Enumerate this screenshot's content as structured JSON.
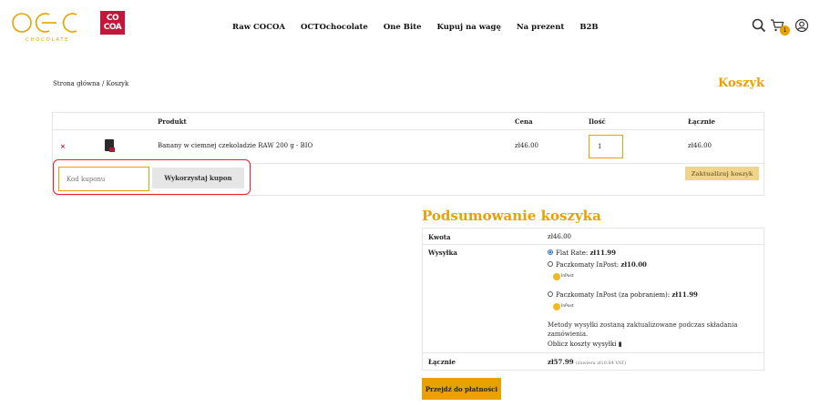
{
  "brand": {
    "logo_top": "CO\nCOA",
    "logo_sub": "CHOCOLATE",
    "accent_color": "#e8a200",
    "brand_red": "#c4163a"
  },
  "nav": {
    "items": [
      "Raw COCOA",
      "OCTOchocolate",
      "One Bite",
      "Kupuj na wagę",
      "Na prezent",
      "B2B"
    ]
  },
  "header": {
    "icons": [
      "search-icon",
      "cart-icon",
      "user-icon"
    ],
    "cart_count": "1"
  },
  "breadcrumb": "Strona główna / Koszyk",
  "page_title": "Koszyk",
  "cart": {
    "headers": {
      "product": "Produkt",
      "price": "Cena",
      "qty": "Ilość",
      "total": "Łącznie"
    },
    "rows": [
      {
        "remove": "×",
        "name": "Banany w ciemnej czekoladzie RAW 200 g - BIO",
        "price": "zł46.00",
        "qty": "1",
        "total": "zł46.00"
      }
    ],
    "coupon_placeholder": "Kod kuponu",
    "coupon_button": "Wykorzystaj kupon",
    "update_button": "Zaktualizuj koszyk"
  },
  "summary": {
    "title": "Podsumowanie koszyka",
    "subtotal_label": "Kwota",
    "subtotal_value": "zł46.00",
    "shipping_label": "Wysyłka",
    "options": [
      {
        "label": "Flat Rate: ",
        "price": "zł11.99",
        "selected": true
      },
      {
        "label": "Paczkomaty InPost: ",
        "price": "zł10.00",
        "selected": false,
        "logo": "InPost"
      },
      {
        "label": "Paczkomaty InPost (za pobraniem): ",
        "price": "zł11.99",
        "selected": false,
        "logo": "InPost"
      }
    ],
    "shipping_note": "Metody wysyłki zostaną zaktualizowane podczas składania zamówienia.",
    "calculate_label": "Oblicz koszty wysyłki",
    "total_label": "Łącznie",
    "total_value": "zł57.99",
    "total_vat": "(zawiera zł10.84 VAT)",
    "checkout_button": "Przejdź do płatności"
  }
}
